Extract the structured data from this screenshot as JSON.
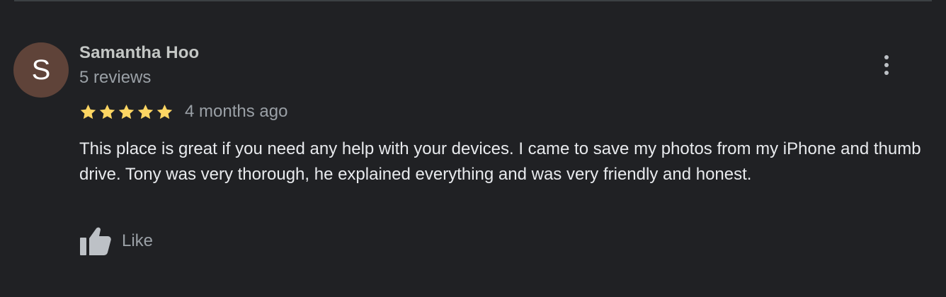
{
  "review": {
    "avatar_initial": "S",
    "author_name": "Samantha Hoo",
    "review_count": "5 reviews",
    "rating": 5,
    "rating_max": 5,
    "date": "4 months ago",
    "text": "This place is great if you need any help with your devices. I came to save my photos from my iPhone and thumb drive. Tony was very thorough, he explained everything and was very friendly and honest.",
    "like_label": "Like"
  },
  "icons": {
    "more": "more-vert-icon",
    "star": "star-icon",
    "like": "thumb-up-icon"
  },
  "colors": {
    "background": "#202124",
    "avatar": "#5f4339",
    "star": "#fdd663",
    "name": "#c4c7c5",
    "secondary_text": "#9aa0a6",
    "body_text": "#e8eaed",
    "icon": "#bdc1c6"
  }
}
